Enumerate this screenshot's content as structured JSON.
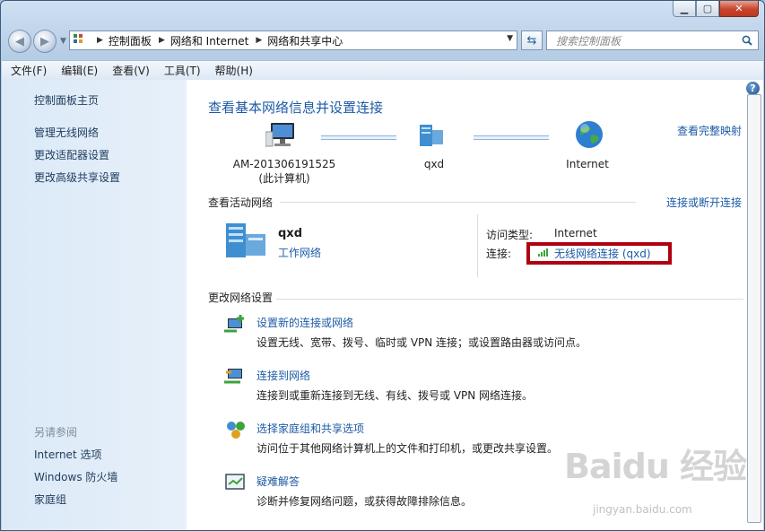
{
  "window": {
    "buttons": {
      "minimize": "▁",
      "maximize": "▢",
      "close": "✕"
    }
  },
  "nav": {
    "breadcrumbs": [
      "控制面板",
      "网络和 Internet",
      "网络和共享中心"
    ],
    "search_placeholder": "搜索控制面板"
  },
  "menu": [
    "文件(F)",
    "编辑(E)",
    "查看(V)",
    "工具(T)",
    "帮助(H)"
  ],
  "sidebar": {
    "home": "控制面板主页",
    "links": [
      "管理无线网络",
      "更改适配器设置",
      "更改高级共享设置"
    ],
    "see_also_heading": "另请参阅",
    "see_also": [
      "Internet 选项",
      "Windows 防火墙",
      "家庭组"
    ]
  },
  "main": {
    "title": "查看基本网络信息并设置连接",
    "full_map": "查看完整映射",
    "nodes": {
      "computer_name": "AM-201306191525",
      "computer_sub": "(此计算机)",
      "network": "qxd",
      "internet": "Internet"
    },
    "active": {
      "title": "查看活动网络",
      "connect_link": "连接或断开连接",
      "network_name": "qxd",
      "network_type": "工作网络",
      "access_type_label": "访问类型:",
      "access_type_value": "Internet",
      "connection_label": "连接:",
      "connection_value": "无线网络连接 (qxd)"
    },
    "change": {
      "title": "更改网络设置",
      "tasks": [
        {
          "link": "设置新的连接或网络",
          "desc": "设置无线、宽带、拨号、临时或 VPN 连接；或设置路由器或访问点。"
        },
        {
          "link": "连接到网络",
          "desc": "连接到或重新连接到无线、有线、拨号或 VPN 网络连接。"
        },
        {
          "link": "选择家庭组和共享选项",
          "desc": "访问位于其他网络计算机上的文件和打印机，或更改共享设置。"
        },
        {
          "link": "疑难解答",
          "desc": "诊断并修复网络问题，或获得故障排除信息。"
        }
      ]
    }
  },
  "watermark": {
    "logo": "Baidu 经验",
    "sub": "jingyan.baidu.com"
  },
  "colors": {
    "link": "#1d5aa6",
    "highlight_box": "#b00010",
    "sidebar_bg": "#dbe9f7"
  }
}
